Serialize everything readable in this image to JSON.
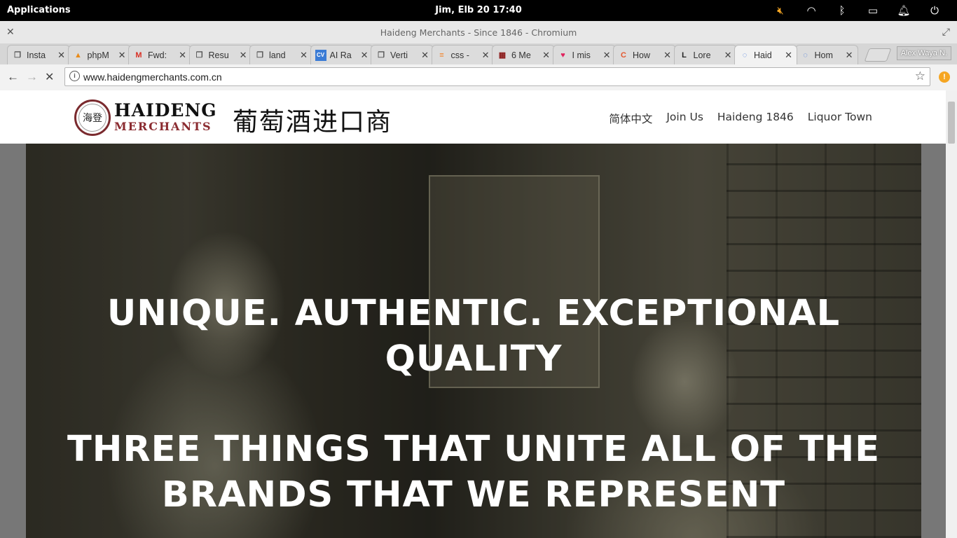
{
  "system_panel": {
    "applications_label": "Applications",
    "clock": "Jim, Elb 20    17:40",
    "tray_icons": [
      "volume-muted-icon",
      "wifi-icon",
      "bluetooth-icon",
      "battery-icon",
      "notification-bell-icon",
      "power-icon"
    ]
  },
  "window": {
    "title": "Haideng Merchants - Since 1846 - Chromium"
  },
  "tabs": [
    {
      "label": "Insta",
      "icon": "page-icon"
    },
    {
      "label": "phpM",
      "icon": "phpmyadmin-icon"
    },
    {
      "label": "Fwd:",
      "icon": "gmail-icon"
    },
    {
      "label": "Resu",
      "icon": "page-icon"
    },
    {
      "label": "land",
      "icon": "page-icon"
    },
    {
      "label": "AI Ra",
      "icon": "cv-icon"
    },
    {
      "label": "Verti",
      "icon": "page-icon"
    },
    {
      "label": "css -",
      "icon": "stackoverflow-icon"
    },
    {
      "label": "6 Me",
      "icon": "grid-icon"
    },
    {
      "label": "I mis",
      "icon": "heart-icon"
    },
    {
      "label": "How",
      "icon": "c-icon"
    },
    {
      "label": "Lore",
      "icon": "l-icon"
    },
    {
      "label": "Haid",
      "icon": "loading-icon",
      "active": true
    },
    {
      "label": "Hom",
      "icon": "loading-icon"
    }
  ],
  "profile_name": "Alex Waya N.",
  "toolbar": {
    "url": "www.haidengmerchants.com.cn"
  },
  "site": {
    "logo": {
      "seal_text": "海登",
      "name_top": "HAIDENG",
      "name_bottom": "MERCHANTS",
      "chinese": "葡萄酒进口商"
    },
    "nav": [
      "简体中文",
      "Join Us",
      "Haideng 1846",
      "Liquor Town"
    ],
    "hero": {
      "headline1": "UNIQUE. AUTHENTIC. EXCEPTIONAL QUALITY",
      "headline2": "THREE THINGS THAT UNITE ALL OF THE BRANDS THAT WE REPRESENT"
    }
  }
}
